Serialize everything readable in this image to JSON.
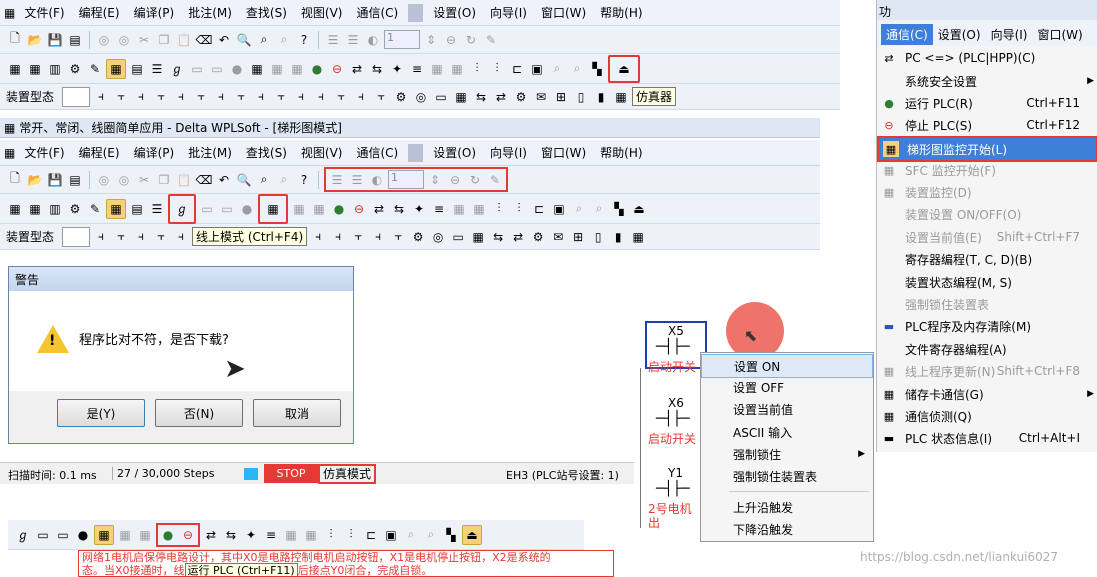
{
  "menubar": [
    "文件(F)",
    "编程(E)",
    "编译(P)",
    "批注(M)",
    "查找(S)",
    "视图(V)",
    "通信(C)",
    "设置(O)",
    "向导(I)",
    "窗口(W)",
    "帮助(H)"
  ],
  "toolbar_step_value": "1",
  "device_label": "装置型态",
  "simulator_label": "仿真器",
  "window_title": "常开、常闭、线圈简单应用 - Delta WPLSoft - [梯形图模式]",
  "online_tooltip": "线上模式 (Ctrl+F4)",
  "dialog": {
    "title": "警告",
    "message": "程序比对不符，是否下载?",
    "yes": "是(Y)",
    "no": "否(N)",
    "cancel": "取消"
  },
  "status": {
    "scan_time": "扫描时间: 0.1 ms",
    "steps": "27 / 30,000 Steps",
    "stop": "STOP",
    "sim_mode": "仿真模式",
    "plc": "EH3 (PLC站号设置: 1)"
  },
  "bottom": {
    "run_tooltip": "运行 PLC (Ctrl+F11)",
    "comment_1": "网络1电机启保停电路设计，其中X0是电路控制电机启动按钮，X1是电机停止按钮，X2是系统的",
    "comment_2": "态。当X0接通时，线",
    "comment_3": "后接点Y0闭合，完成自锁。"
  },
  "ladder": {
    "x5": "X5",
    "x5_label": "启动开关",
    "x6": "X6",
    "x6_label": "启动开关",
    "y1": "Y1",
    "y1_label": "2号电机",
    "y1_label2": "出"
  },
  "context_menu": [
    "设置 ON",
    "设置 OFF",
    "设置当前值",
    "ASCII 输入",
    "强制锁住",
    "强制锁住装置表",
    "上升沿触发",
    "下降沿触发"
  ],
  "right_menubar": [
    "通信(C)",
    "设置(O)",
    "向导(I)",
    "窗口(W)"
  ],
  "comm_menu": [
    {
      "label": "PC <=> (PLC|HPP)(C)",
      "shortcut": "",
      "disabled": false
    },
    {
      "label": "系统安全设置",
      "shortcut": "",
      "disabled": false
    },
    {
      "label": "运行 PLC(R)",
      "shortcut": "Ctrl+F11",
      "disabled": false
    },
    {
      "label": "停止 PLC(S)",
      "shortcut": "Ctrl+F12",
      "disabled": false
    },
    {
      "label": "梯形图监控开始(L)",
      "shortcut": "",
      "disabled": false
    },
    {
      "label": "SFC 监控开始(F)",
      "shortcut": "",
      "disabled": true
    },
    {
      "label": "装置监控(D)",
      "shortcut": "",
      "disabled": true
    },
    {
      "label": "装置设置 ON/OFF(O)",
      "shortcut": "",
      "disabled": true
    },
    {
      "label": "设置当前值(E)",
      "shortcut": "Shift+Ctrl+F7",
      "disabled": true
    },
    {
      "label": "寄存器编程(T, C, D)(B)",
      "shortcut": "",
      "disabled": false
    },
    {
      "label": "装置状态编程(M, S)",
      "shortcut": "",
      "disabled": false
    },
    {
      "label": "强制锁住装置表",
      "shortcut": "",
      "disabled": true
    },
    {
      "label": "PLC程序及内存清除(M)",
      "shortcut": "",
      "disabled": false
    },
    {
      "label": "文件寄存器编程(A)",
      "shortcut": "",
      "disabled": false
    },
    {
      "label": "线上程序更新(N)",
      "shortcut": "Shift+Ctrl+F8",
      "disabled": true
    },
    {
      "label": "储存卡通信(G)",
      "shortcut": "",
      "disabled": false
    },
    {
      "label": "通信侦测(Q)",
      "shortcut": "",
      "disabled": false
    },
    {
      "label": "PLC 状态信息(I)",
      "shortcut": "Ctrl+Alt+I",
      "disabled": false
    }
  ],
  "right_title_fragment": "功",
  "watermark": "https://blog.csdn.net/liankui6027"
}
